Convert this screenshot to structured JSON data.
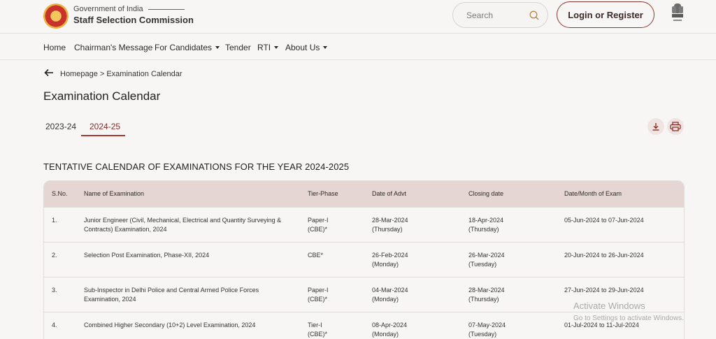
{
  "header": {
    "gov_label": "Government of India",
    "org_name": "Staff Selection Commission",
    "search_placeholder": "Search",
    "login_label": "Login or Register",
    "logo_icon": "ssc-logo-icon",
    "emblem_icon": "national-emblem-icon"
  },
  "nav": {
    "items": [
      {
        "label": "Home",
        "dropdown": false
      },
      {
        "label": "Chairman's Message",
        "dropdown": false
      },
      {
        "label": "For Candidates",
        "dropdown": true
      },
      {
        "label": "Tender",
        "dropdown": false
      },
      {
        "label": "RTI",
        "dropdown": true
      },
      {
        "label": "About Us",
        "dropdown": true
      }
    ]
  },
  "breadcrumb": {
    "text": "Homepage > Examination Calendar"
  },
  "page": {
    "title": "Examination Calendar",
    "tabs": [
      {
        "label": "2023-24",
        "active": false
      },
      {
        "label": "2024-25",
        "active": true
      }
    ],
    "section_title": "TENTATIVE CALENDAR OF EXAMINATIONS FOR THE YEAR 2024-2025"
  },
  "table": {
    "headers": [
      "S.No.",
      "Name of Examination",
      "Tier-Phase",
      "Date of Advt",
      "Closing date",
      "Date/Month of Exam"
    ],
    "rows": [
      {
        "sno": "1.",
        "name_l1": "Junior Engineer (Civil, Mechanical, Electrical and Quantity Surveying &",
        "name_l2": "Contracts) Examination, 2024",
        "tier_l1": "Paper-I",
        "tier_l2": "(CBE)*",
        "advt_l1": "28-Mar-2024",
        "advt_l2": "(Thursday)",
        "close_l1": "18-Apr-2024",
        "close_l2": "(Thursday)",
        "exam": "05-Jun-2024 to 07-Jun-2024"
      },
      {
        "sno": "2.",
        "name_l1": "Selection Post Examination, Phase-XII, 2024",
        "name_l2": "",
        "tier_l1": "CBE*",
        "tier_l2": "",
        "advt_l1": "26-Feb-2024",
        "advt_l2": "(Monday)",
        "close_l1": "26-Mar-2024",
        "close_l2": "(Tuesday)",
        "exam": "20-Jun-2024 to 26-Jun-2024"
      },
      {
        "sno": "3.",
        "name_l1": "Sub-Inspector in Delhi Police and Central Armed Police Forces",
        "name_l2": "Examination, 2024",
        "tier_l1": "Paper-I",
        "tier_l2": "(CBE)*",
        "advt_l1": "04-Mar-2024",
        "advt_l2": "(Monday)",
        "close_l1": "28-Mar-2024",
        "close_l2": "(Thursday)",
        "exam": "27-Jun-2024 to 29-Jun-2024"
      },
      {
        "sno": "4.",
        "name_l1": "Combined Higher Secondary (10+2) Level Examination, 2024",
        "name_l2": "",
        "tier_l1": "Tier-I",
        "tier_l2": "(CBE)*",
        "advt_l1": "08-Apr-2024",
        "advt_l2": "(Monday)",
        "close_l1": "07-May-2024",
        "close_l2": "(Tuesday)",
        "exam": "01-Jul-2024 to 11-Jul-2024"
      }
    ]
  },
  "watermark": {
    "title": "Activate Windows",
    "subtitle": "Go to Settings to activate Windows."
  },
  "colors": {
    "accent": "#9e3a32",
    "header_row": "#e5d6d4",
    "background": "#f7f6f5"
  }
}
